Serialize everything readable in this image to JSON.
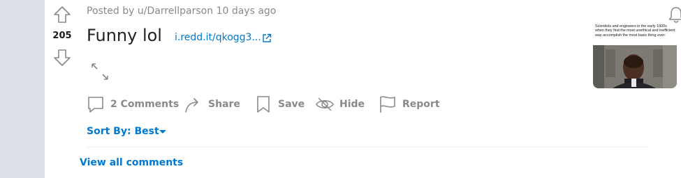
{
  "post": {
    "score": "205",
    "author_meta": "Posted by u/Darrellparson 10 days ago",
    "title": "Funny lol",
    "link_text": "i.redd.it/qkogg3..."
  },
  "thumbnail": {
    "caption": "Scientists and engineers in the early 1900s when they find the most unethical and inefficient way accomplish the most basic thing ever:"
  },
  "actions": {
    "comments": "2 Comments",
    "share": "Share",
    "save": "Save",
    "hide": "Hide",
    "report": "Report"
  },
  "comments_section": {
    "sort_label": "Sort By: Best",
    "view_all": "View all comments"
  },
  "icons": {
    "upvote": "arrow-up-icon",
    "downvote": "arrow-down-icon",
    "external": "external-link-icon",
    "expand": "expand-icon",
    "bell": "bell-icon",
    "comment": "comment-icon",
    "share": "share-icon",
    "save": "bookmark-icon",
    "hide": "eye-slash-icon",
    "report": "flag-icon",
    "caret": "caret-down-icon"
  },
  "colors": {
    "link": "#0079d3",
    "muted": "#878a8c",
    "gutter": "#dae0e6",
    "title": "#222222"
  }
}
